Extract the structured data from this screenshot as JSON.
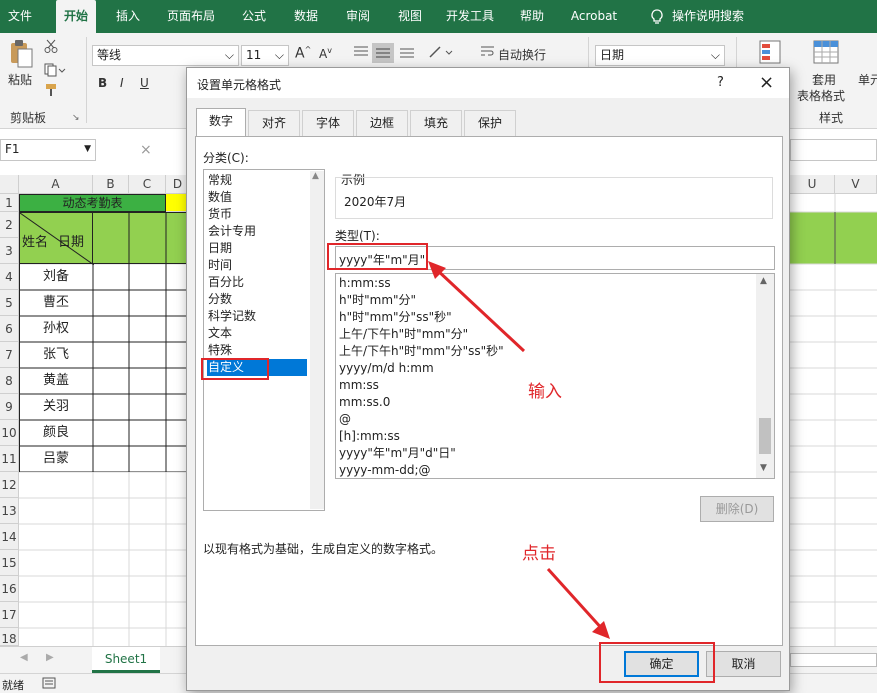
{
  "ribbon_tabs": [
    "文件",
    "开始",
    "插入",
    "页面布局",
    "公式",
    "数据",
    "审阅",
    "视图",
    "开发工具",
    "帮助",
    "Acrobat",
    "操作说明搜索"
  ],
  "ribbon": {
    "paste_label": "粘贴",
    "clipboard_group": "剪贴板",
    "font_name": "等线",
    "font_size": "11",
    "wrap_text": "自动换行",
    "number_format": "日期",
    "table_format": "套用",
    "table_format2": "表格格式",
    "cell_style": "单元",
    "styles_group": "样式",
    "bold": "B",
    "italic": "I",
    "underline": "U"
  },
  "formula_bar": {
    "name_box": "F1",
    "cancel": "×"
  },
  "columns": [
    "A",
    "B",
    "C",
    "D",
    "U",
    "V"
  ],
  "rows": [
    "1",
    "2",
    "3",
    "4",
    "5",
    "6",
    "7",
    "8",
    "9",
    "10",
    "11",
    "12",
    "13",
    "14",
    "15",
    "16",
    "17",
    "18"
  ],
  "sheet": {
    "title": "动态考勤表",
    "header_name": "姓名",
    "header_date": "日期",
    "names": [
      "刘备",
      "曹丕",
      "孙权",
      "张飞",
      "黄盖",
      "关羽",
      "颜良",
      "吕蒙"
    ]
  },
  "sheet_tab": "Sheet1",
  "status": "就绪",
  "dialog": {
    "title": "设置单元格格式",
    "help": "?",
    "close": "×",
    "tabs": [
      "数字",
      "对齐",
      "字体",
      "边框",
      "填充",
      "保护"
    ],
    "category_label": "分类(C):",
    "categories": [
      "常规",
      "数值",
      "货币",
      "会计专用",
      "日期",
      "时间",
      "百分比",
      "分数",
      "科学记数",
      "文本",
      "特殊",
      "自定义"
    ],
    "sample_label": "示例",
    "sample_value": "2020年7月",
    "type_label": "类型(T):",
    "type_value": "yyyy\"年\"m\"月\"",
    "formats": [
      "h:mm:ss",
      "h\"时\"mm\"分\"",
      "h\"时\"mm\"分\"ss\"秒\"",
      "上午/下午h\"时\"mm\"分\"",
      "上午/下午h\"时\"mm\"分\"ss\"秒\"",
      "yyyy/m/d h:mm",
      "mm:ss",
      "mm:ss.0",
      "@",
      "[h]:mm:ss",
      "yyyy\"年\"m\"月\"d\"日\"",
      "yyyy-mm-dd;@"
    ],
    "delete_button": "删除(D)",
    "description": "以现有格式为基础，生成自定义的数字格式。",
    "ok_button": "确定",
    "cancel_button": "取消"
  },
  "annotations": {
    "input": "输入",
    "click": "点击"
  },
  "colors": {
    "excel_green": "#217346",
    "title_fill": "#3cb043",
    "header_fill": "#92d050",
    "selection_blue": "#0078d7",
    "annotation_red": "#e0262a"
  }
}
